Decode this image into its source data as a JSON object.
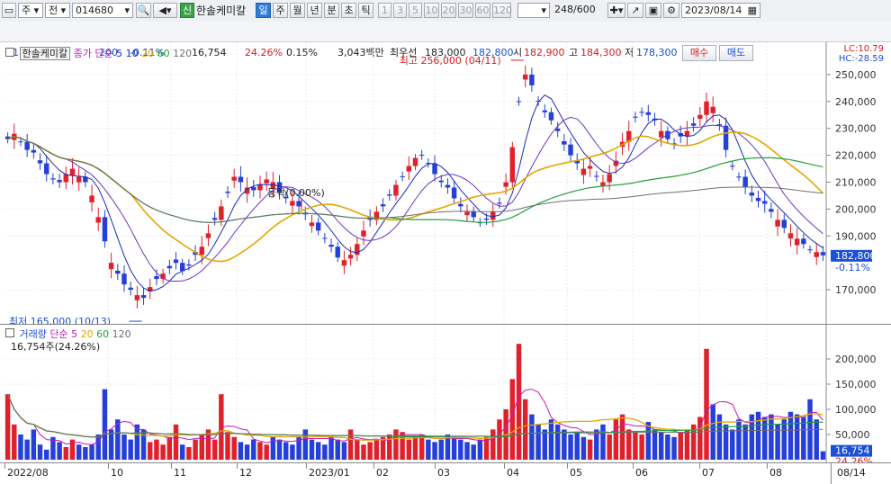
{
  "toolbar": {
    "market": "주",
    "market2": "전",
    "code": "014680",
    "stock_badge": "신",
    "stock_name": "한솔케미칼",
    "periods": [
      "일",
      "주",
      "월",
      "년",
      "분",
      "초",
      "틱"
    ],
    "active_period": "일",
    "intervals": [
      "1",
      "3",
      "5",
      "10",
      "20",
      "30",
      "60",
      "120"
    ],
    "count": "248",
    "count_max": "/600",
    "date": "2023/08/14",
    "icons": [
      "chart-window-icon",
      "dropdown-icon",
      "search-icon",
      "speaker-icon",
      "tools-icon",
      "chart-line-icon",
      "save-icon",
      "settings-icon",
      "calendar-icon"
    ]
  },
  "quote": {
    "price": "182,800",
    "arrow": "▼",
    "change": "200",
    "change_pct": "-0.11%",
    "volume": "16,754",
    "vol_ratio": "24.26%",
    "turnover": "0.15%",
    "amount": "3,043백만",
    "pref_label": "최우선",
    "pref_value": "183,000",
    "bid": "182,800",
    "open_label": "시",
    "open": "182,900",
    "high_label": "고",
    "high": "184,300",
    "low_label": "저",
    "low": "178,300",
    "buy": "매수",
    "sell": "매도"
  },
  "price_panel": {
    "legend_name": "한솔케미칼",
    "legend_ma": "종가 단순",
    "ma": [
      {
        "label": "5",
        "color": "#1b2bb8"
      },
      {
        "label": "10",
        "color": "#1b2bb8"
      },
      {
        "label": "20",
        "color": "#e3a600"
      },
      {
        "label": "60",
        "color": "#21a039"
      },
      {
        "label": "120",
        "color": "#707070"
      }
    ],
    "lc": "LC:10.79",
    "hc": "HC:-28.59",
    "high_annot": "최고 256,000 (04/11)",
    "low_annot": "최저 165,000 (10/13)",
    "mid_annot": "등락(0.00%)",
    "yticks": [
      "250,000",
      "240,000",
      "230,000",
      "220,000",
      "210,000",
      "200,000",
      "190,000",
      "170,000"
    ],
    "last_price": "182,800",
    "last_pct": "-0.11%"
  },
  "volume_panel": {
    "legend_name": "거래량",
    "legend_ma": "단순 5",
    "ma": [
      {
        "label": "20",
        "color": "#e3a600"
      },
      {
        "label": "60",
        "color": "#21a039"
      },
      {
        "label": "120",
        "color": "#707070"
      }
    ],
    "info": "16,754주(24.26%)",
    "yticks": [
      "200,000",
      "150,000",
      "100,000",
      "50,000"
    ],
    "last_vol": "16,754",
    "last_pct": "24.26%"
  },
  "x_axis": {
    "labels": [
      "2022/08",
      "10",
      "11",
      "12",
      "2023/01",
      "02",
      "03",
      "04",
      "05",
      "06",
      "07",
      "08"
    ],
    "right_label": "08/14"
  },
  "chart_data": {
    "type": "candlestick",
    "price_range": [
      160000,
      260000
    ],
    "volume_range": [
      0,
      250000
    ],
    "highest": {
      "value": 256000,
      "date": "04/11"
    },
    "lowest": {
      "value": 165000,
      "date": "10/13"
    },
    "closes": [
      226000,
      228000,
      225000,
      222000,
      221000,
      217000,
      213000,
      211000,
      210000,
      213000,
      215000,
      212000,
      210000,
      205000,
      197000,
      188000,
      180000,
      176000,
      172000,
      170000,
      168000,
      167000,
      171000,
      174000,
      176000,
      178000,
      180000,
      177000,
      179000,
      183000,
      186000,
      191000,
      196000,
      201000,
      206000,
      212000,
      210000,
      208000,
      207000,
      209000,
      211000,
      210000,
      206000,
      204000,
      203000,
      201000,
      198000,
      195000,
      192000,
      189000,
      186000,
      182000,
      181000,
      183000,
      187000,
      192000,
      196000,
      199000,
      201000,
      205000,
      209000,
      212000,
      216000,
      219000,
      220000,
      217000,
      213000,
      210000,
      208000,
      204000,
      201000,
      199000,
      197000,
      195000,
      196000,
      199000,
      202000,
      210000,
      223000,
      240000,
      250000,
      246000,
      240000,
      236000,
      233000,
      229000,
      224000,
      220000,
      217000,
      215000,
      216000,
      212000,
      210000,
      213000,
      218000,
      225000,
      229000,
      234000,
      236000,
      235000,
      233000,
      229000,
      226000,
      224000,
      227000,
      229000,
      231000,
      235000,
      240000,
      238000,
      231000,
      222000,
      216000,
      212000,
      208000,
      205000,
      203000,
      202000,
      199000,
      196000,
      193000,
      191000,
      189000,
      187000,
      185000,
      184000,
      182800
    ],
    "volumes": [
      130000,
      70000,
      50000,
      40000,
      60000,
      30000,
      20000,
      45000,
      35000,
      25000,
      40000,
      30000,
      25000,
      30000,
      50000,
      140000,
      60000,
      80000,
      50000,
      40000,
      70000,
      60000,
      35000,
      40000,
      30000,
      45000,
      70000,
      30000,
      25000,
      40000,
      50000,
      60000,
      40000,
      130000,
      55000,
      45000,
      35000,
      30000,
      40000,
      35000,
      30000,
      45000,
      40000,
      35000,
      30000,
      45000,
      60000,
      40000,
      35000,
      30000,
      45000,
      40000,
      35000,
      60000,
      40000,
      30000,
      35000,
      40000,
      45000,
      50000,
      60000,
      55000,
      40000,
      45000,
      50000,
      40000,
      35000,
      40000,
      50000,
      45000,
      40000,
      35000,
      30000,
      40000,
      45000,
      60000,
      80000,
      100000,
      160000,
      230000,
      120000,
      90000,
      70000,
      60000,
      80000,
      70000,
      60000,
      50000,
      55000,
      45000,
      40000,
      60000,
      70000,
      50000,
      80000,
      90000,
      60000,
      55000,
      50000,
      75000,
      60000,
      55000,
      50000,
      45000,
      55000,
      60000,
      70000,
      85000,
      220000,
      110000,
      90000,
      70000,
      60000,
      80000,
      70000,
      90000,
      95000,
      85000,
      90000,
      70000,
      80000,
      95000,
      90000,
      85000,
      120000,
      80000,
      16754
    ],
    "series": [
      {
        "name": "5",
        "color": "#1b2bb8"
      },
      {
        "name": "10",
        "color": "#1b2bb8"
      },
      {
        "name": "20",
        "color": "#e3a600"
      },
      {
        "name": "60",
        "color": "#21a039"
      },
      {
        "name": "120",
        "color": "#707070"
      }
    ]
  }
}
